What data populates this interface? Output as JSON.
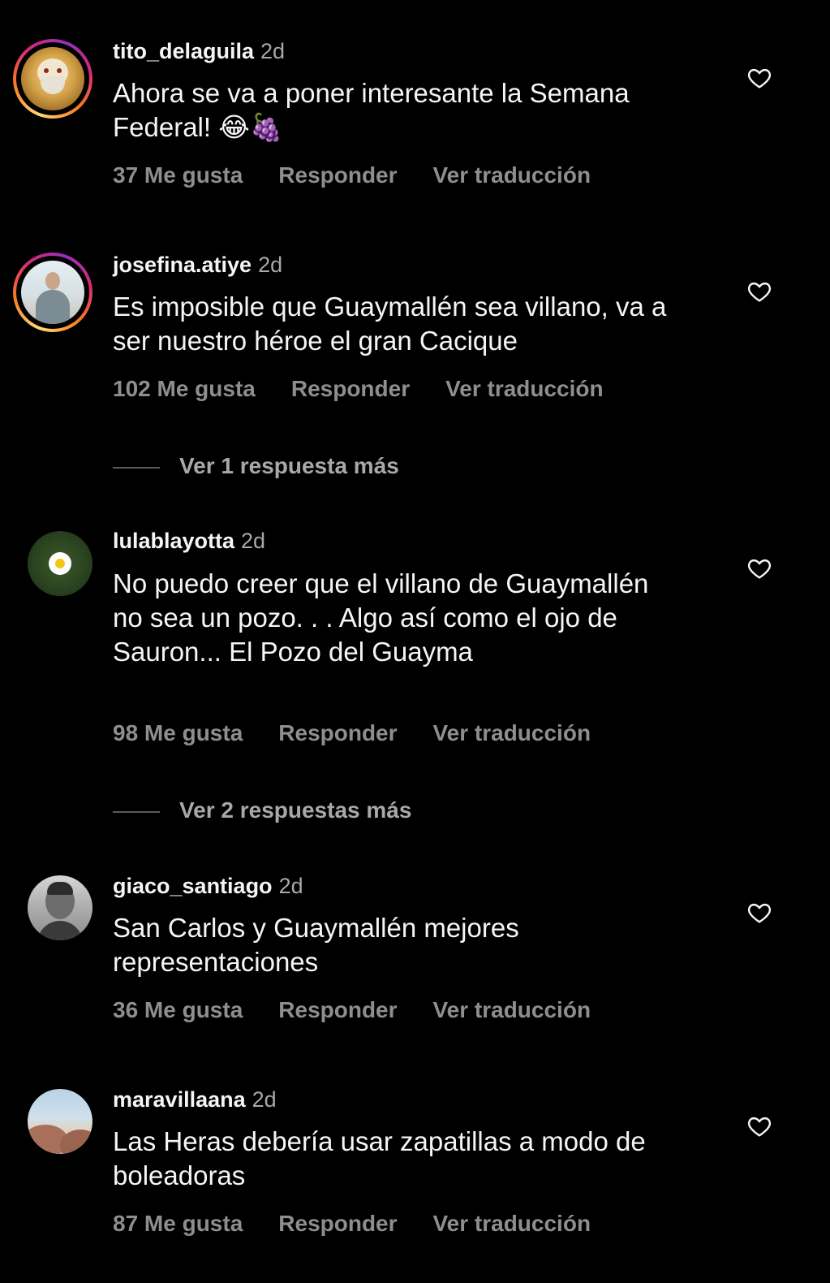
{
  "comments": [
    {
      "user": "tito_delaguila",
      "time": "2d",
      "text": "Ahora se va a poner interesante la Semana Federal! 😂🍇",
      "likes": "37 Me gusta",
      "reply": "Responder",
      "translate": "Ver traducción"
    },
    {
      "user": "josefina.atiye",
      "time": "2d",
      "text": "Es imposible que Guaymallén sea villano, va a ser nuestro héroe el gran Cacique",
      "likes": "102 Me gusta",
      "reply": "Responder",
      "translate": "Ver traducción",
      "more_replies": "Ver 1 respuesta más"
    },
    {
      "user": "lulablayotta",
      "time": "2d",
      "text": "No puedo creer que el villano de Guaymallén no sea un pozo. . . Algo así como el ojo de Sauron... El Pozo del Guayma",
      "likes": "98 Me gusta",
      "reply": "Responder",
      "translate": "Ver traducción",
      "more_replies": "Ver 2 respuestas más"
    },
    {
      "user": "giaco_santiago",
      "time": "2d",
      "text": "San Carlos y Guaymallén mejores representaciones",
      "likes": "36 Me gusta",
      "reply": "Responder",
      "translate": "Ver traducción"
    },
    {
      "user": "maravillaana",
      "time": "2d",
      "text": "Las Heras debería usar zapatillas a modo de boleadoras",
      "likes": "87 Me gusta",
      "reply": "Responder",
      "translate": "Ver traducción"
    }
  ],
  "icons": {
    "like": "heart-outline-icon"
  },
  "colors": {
    "background": "#000000",
    "text": "#f5f5f5",
    "muted": "#8e8e8e"
  }
}
